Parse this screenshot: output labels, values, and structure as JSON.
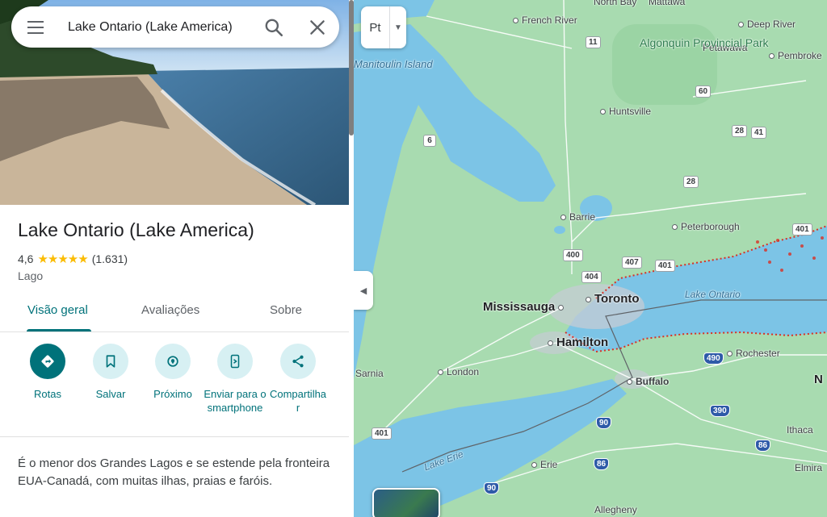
{
  "search": {
    "value": "Lake Ontario (Lake America)"
  },
  "place": {
    "title": "Lake Ontario (Lake America)",
    "rating": "4,6",
    "review_count": "(1.631)",
    "stars": "★★★★★",
    "category": "Lago"
  },
  "tabs": [
    {
      "label": "Visão geral"
    },
    {
      "label": "Avaliações"
    },
    {
      "label": "Sobre"
    }
  ],
  "actions": [
    {
      "label": "Rotas"
    },
    {
      "label": "Salvar"
    },
    {
      "label": "Próximo"
    },
    {
      "label": "Enviar para o smartphone"
    },
    {
      "label": "Compartilhar"
    }
  ],
  "description": "É o menor dos Grandes Lagos e se estende pela fronteira EUA-Canadá, com muitas ilhas, praias e faróis.",
  "map": {
    "layer_button": "Pt",
    "cities": {
      "french_river": "French River",
      "deep_river": "Deep River",
      "petawawa": "Petawawa",
      "pembroke": "Pembroke",
      "huntsville": "Huntsville",
      "barrie": "Barrie",
      "peterborough": "Peterborough",
      "mississauga": "Mississauga",
      "toronto": "Toronto",
      "hamilton": "Hamilton",
      "rochester": "Rochester",
      "buffalo": "Buffalo",
      "london": "London",
      "sarnia": "Sarnia",
      "ithaca": "Ithaca",
      "erie": "Erie",
      "elmira": "Elmira",
      "allegheny": "Allegheny",
      "north_bay": "North Bay",
      "mattawa": "Mattawa",
      "ny": "N"
    },
    "park": "Algonquin Provincial Park",
    "island": "Manitoulin Island",
    "lake_ontario_label": "Lake Ontario",
    "lake_erie_label": "Lake Erie",
    "shields": [
      "11",
      "6",
      "60",
      "28",
      "41",
      "28",
      "400",
      "404",
      "407",
      "401",
      "401",
      "490",
      "90",
      "390",
      "86",
      "86",
      "90",
      "401"
    ]
  },
  "colors": {
    "accent": "#00727a",
    "water": "#7cc4e6",
    "land": "#a8dbb0",
    "star": "#fbbc04"
  }
}
